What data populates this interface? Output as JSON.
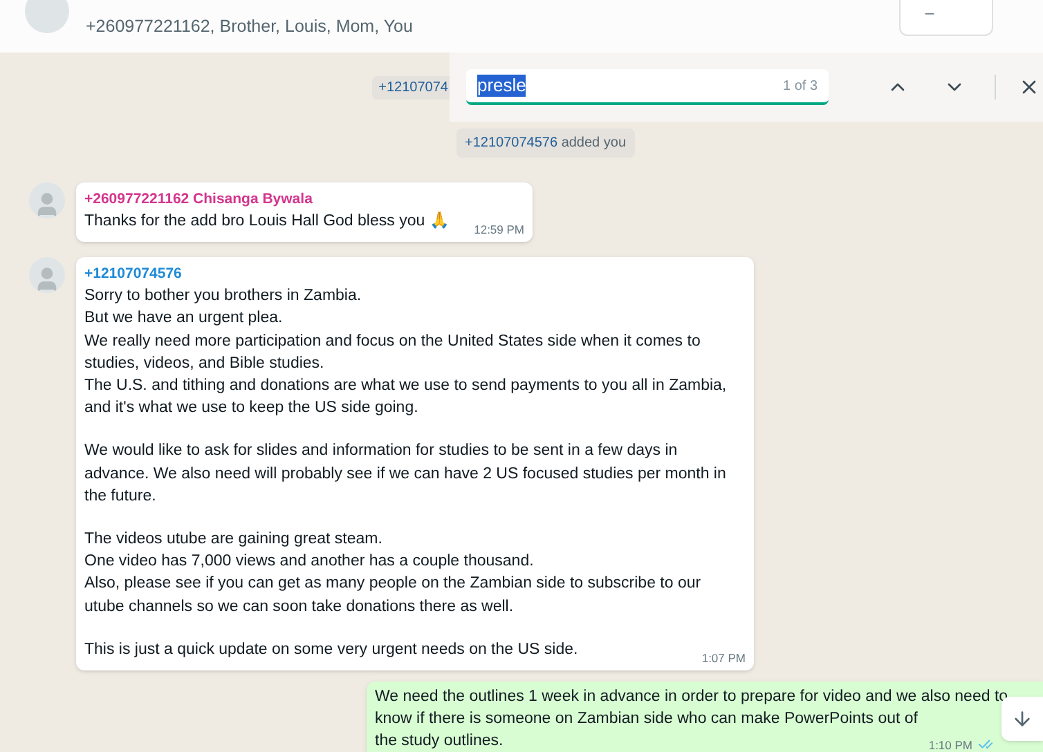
{
  "header": {
    "participants": "+260977221162, Brother, Louis, Mom, You"
  },
  "search": {
    "value": "presle",
    "count": "1 of 3"
  },
  "system_messages": [
    {
      "text": "+12107074",
      "kind": "partial"
    },
    {
      "sender": "+12107074576",
      "text": "added you",
      "kind": "added"
    }
  ],
  "messages": [
    {
      "kind": "incoming",
      "sender": "+260977221162 Chisanga Bywala",
      "color": "#d4358e",
      "paragraphs": [
        [
          "Thanks for the add bro Louis Hall God bless you 🙏"
        ]
      ],
      "time": "12:59 PM"
    },
    {
      "kind": "incoming",
      "sender": "+12107074576",
      "color": "#1d8ad6",
      "paragraphs": [
        [
          "Sorry to bother you brothers in Zambia.",
          "But we have an urgent plea.",
          "We really need more participation and focus on the United States side when it comes to",
          "studies, videos, and Bible studies.",
          "The U.S. and tithing and donations are what we use to send payments to you all in Zambia,",
          "and it's what we use to keep the US side going."
        ],
        [
          "We would like to ask for slides and information for studies to be sent in a few days in",
          "advance. We also need will probably see if we can have 2 US focused studies per month in",
          "the future."
        ],
        [
          "The videos utube are gaining great steam.",
          "One video has 7,000 views and another has a couple thousand.",
          "Also, please see if you can get as many people on the Zambian side to subscribe to our",
          "utube channels so we can soon take donations there as well."
        ],
        [
          "This is just a quick update on some very urgent needs on the US side."
        ]
      ],
      "time": "1:07 PM"
    },
    {
      "kind": "outgoing",
      "paragraphs": [
        [
          "We need the outlines 1 week in advance in order to prepare for video and we also need to",
          "know if there is someone on Zambian side who can make PowerPoints out of",
          "the study outlines."
        ]
      ],
      "time": "1:10 PM",
      "read": true
    }
  ]
}
